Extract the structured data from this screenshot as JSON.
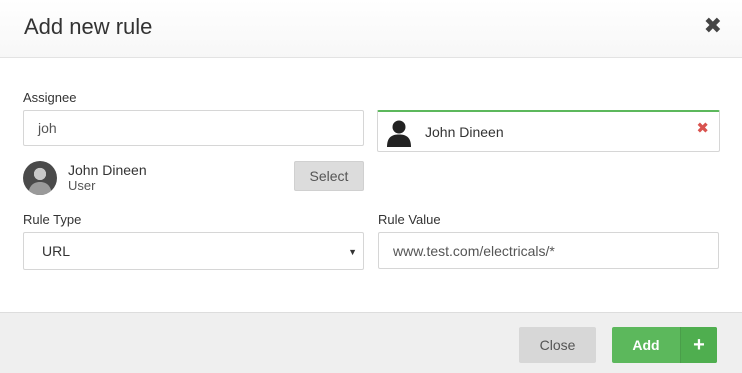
{
  "dialog": {
    "title": "Add new rule",
    "close_glyph": "✖"
  },
  "assignee": {
    "label": "Assignee",
    "input_value": "joh",
    "selected": {
      "name": "John Dineen",
      "icon": "person-icon",
      "remove_glyph": "✖",
      "accent_color": "#5cb85c"
    },
    "suggestion": {
      "name": "John Dineen",
      "role": "User",
      "select_label": "Select"
    }
  },
  "rule_type": {
    "label": "Rule Type",
    "selected_option": "URL",
    "caret_glyph": "▼"
  },
  "rule_value": {
    "label": "Rule Value",
    "input_value": "www.test.com/electricals/*"
  },
  "footer": {
    "close_label": "Close",
    "add_label": "Add",
    "add_plus_glyph": "+",
    "add_color": "#5cb85c"
  }
}
